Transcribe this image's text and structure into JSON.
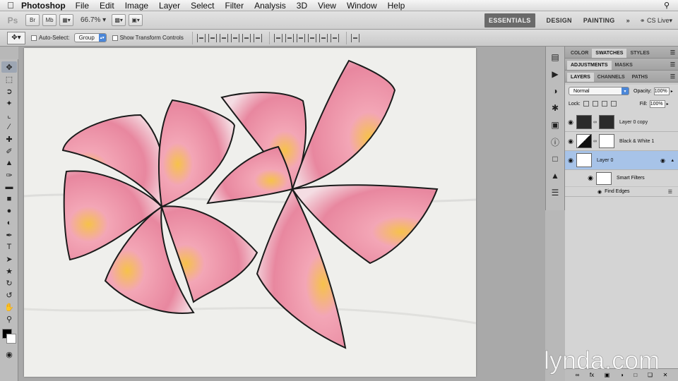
{
  "menubar": {
    "app_name": "Photoshop",
    "items": [
      "File",
      "Edit",
      "Image",
      "Layer",
      "Select",
      "Filter",
      "Analysis",
      "3D",
      "View",
      "Window",
      "Help"
    ]
  },
  "appbar": {
    "logo": "Ps",
    "bridge_btn": "Br",
    "minibridge_btn": "Mb",
    "zoom": "66.7%",
    "workspaces": [
      "ESSENTIALS",
      "DESIGN",
      "PAINTING"
    ],
    "more": "»",
    "cslive": "CS Live"
  },
  "options": {
    "auto_select_label": "Auto-Select:",
    "auto_select_value": "Group",
    "show_transform_label": "Show Transform Controls"
  },
  "panels": {
    "group1_tabs": [
      "COLOR",
      "SWATCHES",
      "STYLES"
    ],
    "group2_tabs": [
      "ADJUSTMENTS",
      "MASKS"
    ],
    "group3_tabs": [
      "LAYERS",
      "CHANNELS",
      "PATHS"
    ]
  },
  "layers": {
    "blend_mode": "Normal",
    "opacity_label": "Opacity:",
    "opacity": "100%",
    "lock_label": "Lock:",
    "fill_label": "Fill:",
    "fill": "100%",
    "items": [
      {
        "name": "Layer 0 copy"
      },
      {
        "name": "Black & White 1"
      },
      {
        "name": "Layer 0"
      }
    ],
    "smart_filters": "Smart Filters",
    "filter_name": "Find Edges"
  },
  "watermark": "lynda.com",
  "icons": {
    "apple": "apple-icon",
    "spotlight": "search-icon",
    "move_tool": "move-tool-icon"
  }
}
